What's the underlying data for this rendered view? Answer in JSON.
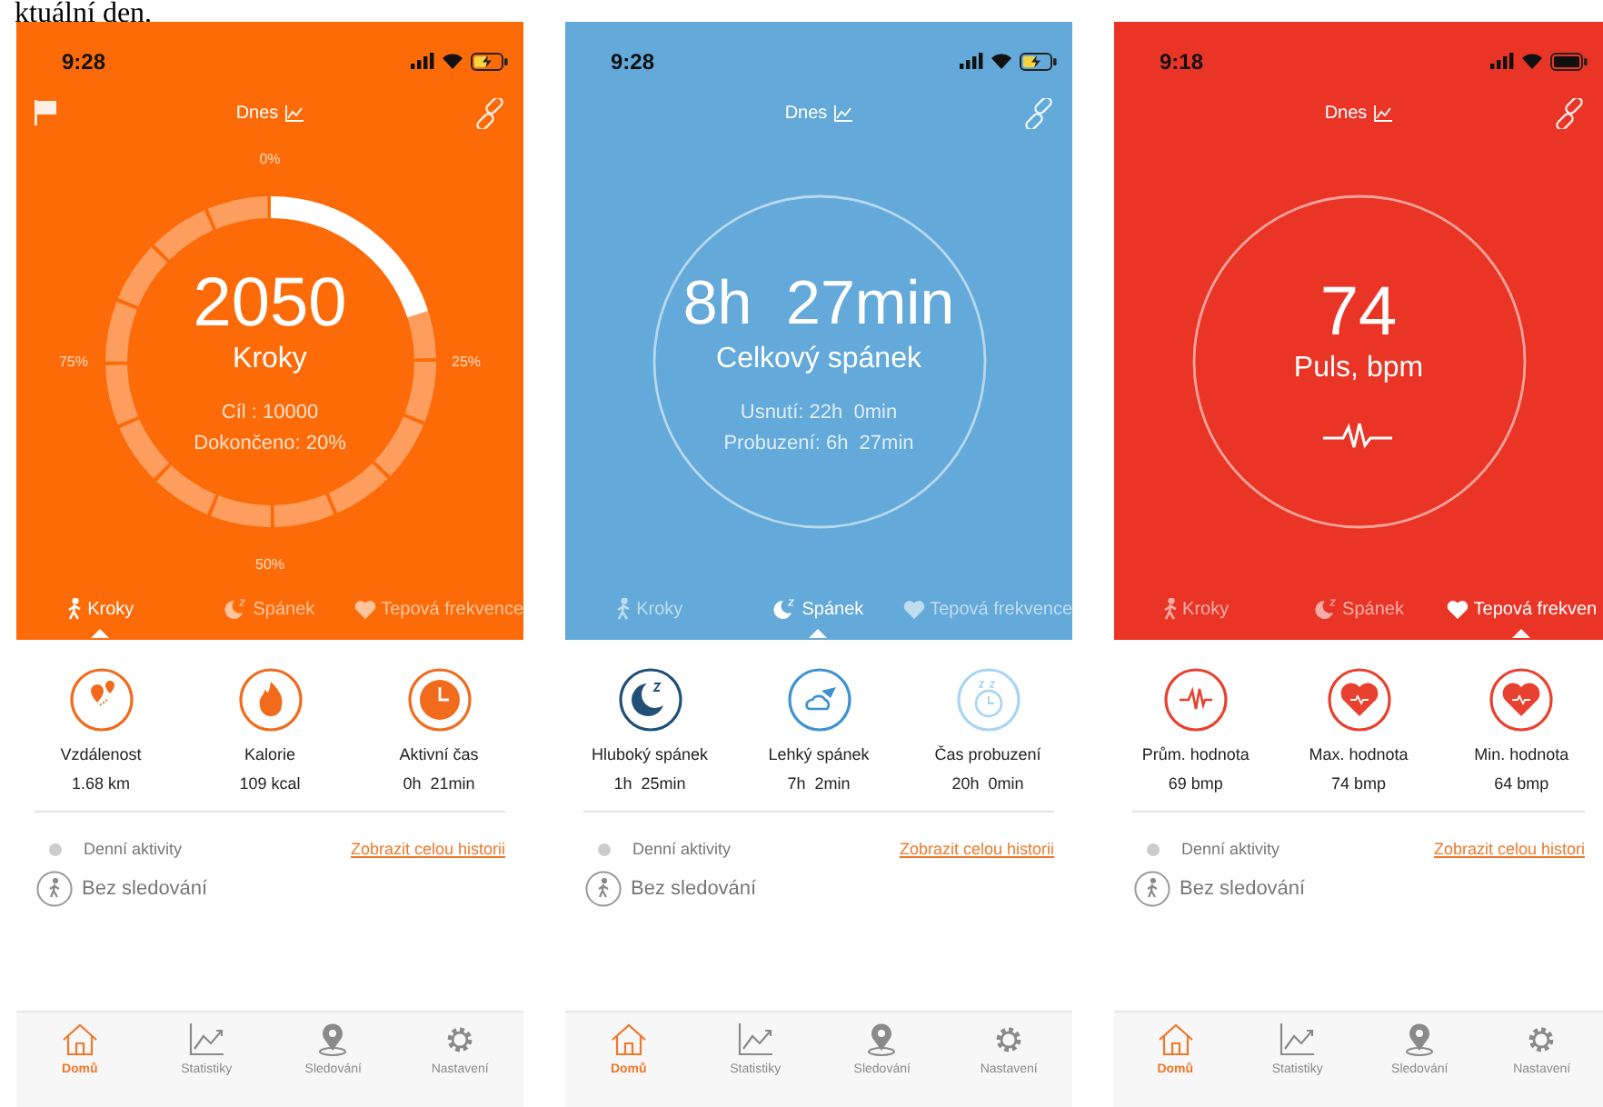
{
  "caption": "ktuální den.",
  "phones": [
    {
      "kind": "steps",
      "time": "9:28",
      "battery_charging": true,
      "flag": true,
      "date_label": "Dnes",
      "dial": {
        "value": "2050",
        "label": "Kroky",
        "lines": [
          "Cíl : 10000",
          "Dokončeno: 20%"
        ],
        "level": 0.2,
        "ticks": [
          "0%",
          "25%",
          "50%",
          "75%"
        ]
      },
      "tabs": [
        {
          "label": "Kroky",
          "selected": true
        },
        {
          "label": "Spánek",
          "selected": false
        },
        {
          "label": "Tepová frekvence",
          "selected": false
        }
      ],
      "stats": [
        {
          "kind": "distance",
          "label": "Vzdálenost",
          "value": "1.68 km"
        },
        {
          "kind": "calories",
          "label": "Kalorie",
          "value": "109 kcal"
        },
        {
          "kind": "clock",
          "label": "Aktivní čas",
          "value": "0h  21min"
        }
      ],
      "timeline": {
        "title": "Denní aktivity",
        "link": "Zobrazit celou historii",
        "status": "Bez sledování"
      },
      "nav": [
        {
          "label": "Domů",
          "selected": true
        },
        {
          "label": "Statistiky",
          "selected": false
        },
        {
          "label": "Sledování",
          "selected": false
        },
        {
          "label": "Nastavení",
          "selected": false
        }
      ]
    },
    {
      "kind": "sleep",
      "time": "9:28",
      "battery_charging": true,
      "flag": false,
      "date_label": "Dnes",
      "dial": {
        "value": "8h  27min",
        "label": "Celkový spánek",
        "lines": [
          "Usnutí: 22h  0min",
          "Probuzení: 6h  27min"
        ]
      },
      "tabs": [
        {
          "label": "Kroky",
          "selected": false
        },
        {
          "label": "Spánek",
          "selected": true
        },
        {
          "label": "Tepová frekvence",
          "selected": false
        }
      ],
      "stats": [
        {
          "kind": "deep",
          "label": "Hluboký spánek",
          "value": "1h  25min"
        },
        {
          "kind": "light",
          "label": "Lehký spánek",
          "value": "7h  2min"
        },
        {
          "kind": "wake",
          "label": "Čas probuzení",
          "value": "20h  0min"
        }
      ],
      "timeline": {
        "title": "Denní aktivity",
        "link": "Zobrazit celou historii",
        "status": "Bez sledování"
      },
      "nav": [
        {
          "label": "Domů",
          "selected": true
        },
        {
          "label": "Statistiky",
          "selected": false
        },
        {
          "label": "Sledování",
          "selected": false
        },
        {
          "label": "Nastavení",
          "selected": false
        }
      ]
    },
    {
      "kind": "heart",
      "time": "9:18",
      "battery_charging": false,
      "flag": false,
      "date_label": "Dnes",
      "dial": {
        "value": "74",
        "label": "Puls, bpm"
      },
      "tabs": [
        {
          "label": "Kroky",
          "selected": false
        },
        {
          "label": "Spánek",
          "selected": false
        },
        {
          "label": "Tepová frekven",
          "selected": true
        }
      ],
      "stats": [
        {
          "kind": "avg",
          "label": "Prům. hodnota",
          "value": "69 bmp"
        },
        {
          "kind": "max",
          "label": "Max. hodnota",
          "value": "74 bmp"
        },
        {
          "kind": "min",
          "label": "Min. hodnota",
          "value": "64 bmp"
        }
      ],
      "timeline": {
        "title": "Denní aktivity",
        "link": "Zobrazit celou histori",
        "status": "Bez sledování"
      },
      "nav": [
        {
          "label": "Domů",
          "selected": true
        },
        {
          "label": "Statistiky",
          "selected": false
        },
        {
          "label": "Sledování",
          "selected": false
        },
        {
          "label": "Nastavení",
          "selected": false
        }
      ]
    }
  ]
}
